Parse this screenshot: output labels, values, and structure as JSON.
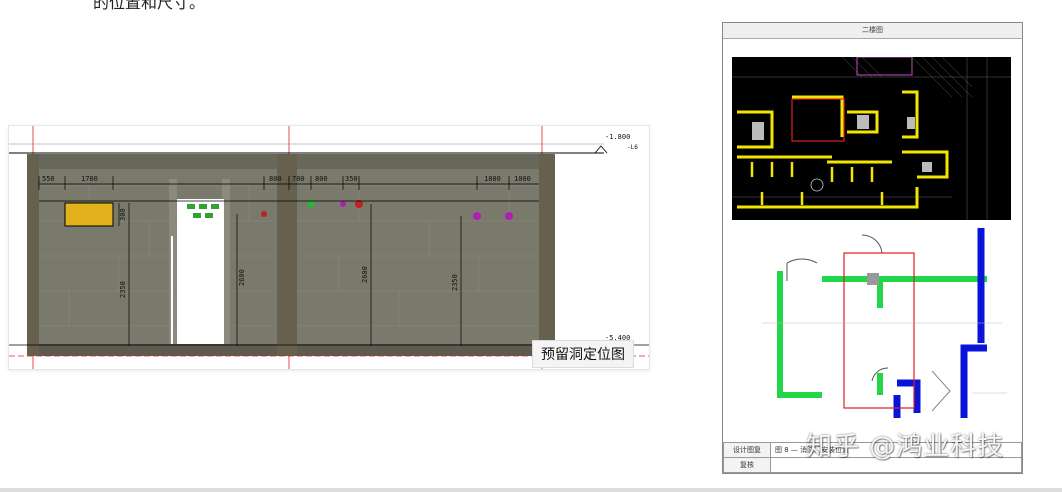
{
  "article": {
    "top_text_fragment": "的位置和尺寸。"
  },
  "elevation_image": {
    "caption": "预留洞定位图",
    "level_top": "-1.800",
    "level_top_tag": "-L6",
    "level_bottom": "-5.400",
    "dims_top": [
      "550",
      "1700",
      "800",
      "700",
      "800",
      "350",
      "1800",
      "1000"
    ],
    "dims_vertical": [
      "300",
      "2350",
      "2600",
      "2600",
      "2350"
    ]
  },
  "drawing_sheet": {
    "title": "二楼图",
    "table_rows": [
      {
        "label": "设计图复",
        "value": "图 8 — 消防门安装位置"
      },
      {
        "label": "复核",
        "value": ""
      }
    ]
  },
  "watermark": {
    "text": "知乎 @鸿业科技"
  },
  "colors": {
    "wall_gray": "#7a7a6c",
    "column_gray": "#6a6558",
    "opening_yellow": "#e2b21c",
    "door_white": "#ffffff",
    "plan_green": "#22d64a",
    "plan_blue": "#0a14d8",
    "cad_yellow": "#f2e600",
    "highlight_red": "#e02020"
  }
}
